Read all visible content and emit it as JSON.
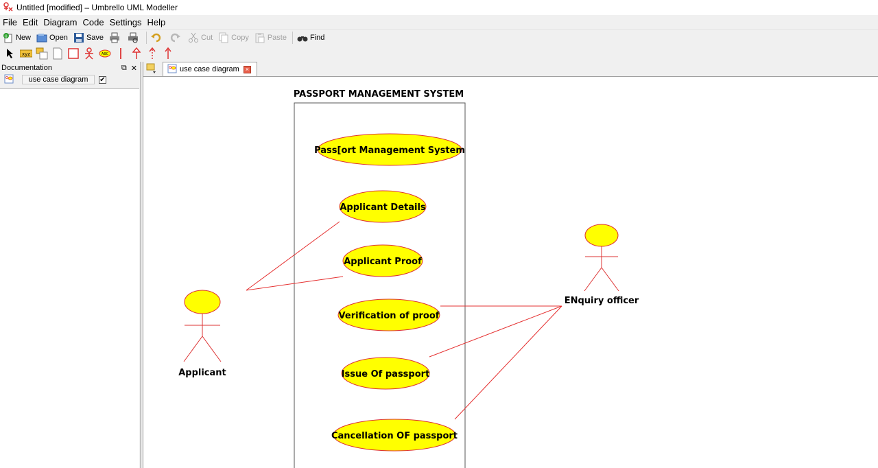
{
  "window": {
    "title": "Untitled [modified] – Umbrello UML Modeller"
  },
  "menubar": [
    "File",
    "Edit",
    "Diagram",
    "Code",
    "Settings",
    "Help"
  ],
  "toolbar": {
    "new": "New",
    "open": "Open",
    "save": "Save",
    "cut": "Cut",
    "copy": "Copy",
    "paste": "Paste",
    "find": "Find"
  },
  "dock": {
    "title": "Documentation",
    "diagram_name": "use case diagram",
    "checkbox_checked": "✔"
  },
  "tabs": [
    {
      "label": "use case diagram",
      "active": true
    }
  ],
  "diagram": {
    "system_boundary_title": "PASSPORT MANAGEMENT SYSTEM",
    "use_cases": [
      "Pass[ort Management System",
      "Applicant Details",
      "Applicant Proof",
      "Verification of proof",
      "Issue Of passport",
      "Cancellation OF passport"
    ],
    "actors": [
      "Applicant",
      "ENquiry officer"
    ],
    "associations": [
      {
        "actor": "Applicant",
        "use_case": "Applicant Details"
      },
      {
        "actor": "Applicant",
        "use_case": "Applicant Proof"
      },
      {
        "actor": "ENquiry officer",
        "use_case": "Verification of proof"
      },
      {
        "actor": "ENquiry officer",
        "use_case": "Issue Of passport"
      },
      {
        "actor": "ENquiry officer",
        "use_case": "Cancellation OF passport"
      }
    ],
    "colors": {
      "use_case_fill": "#ffff00",
      "line": "#e53030",
      "actor_head": "#ffff00"
    }
  }
}
